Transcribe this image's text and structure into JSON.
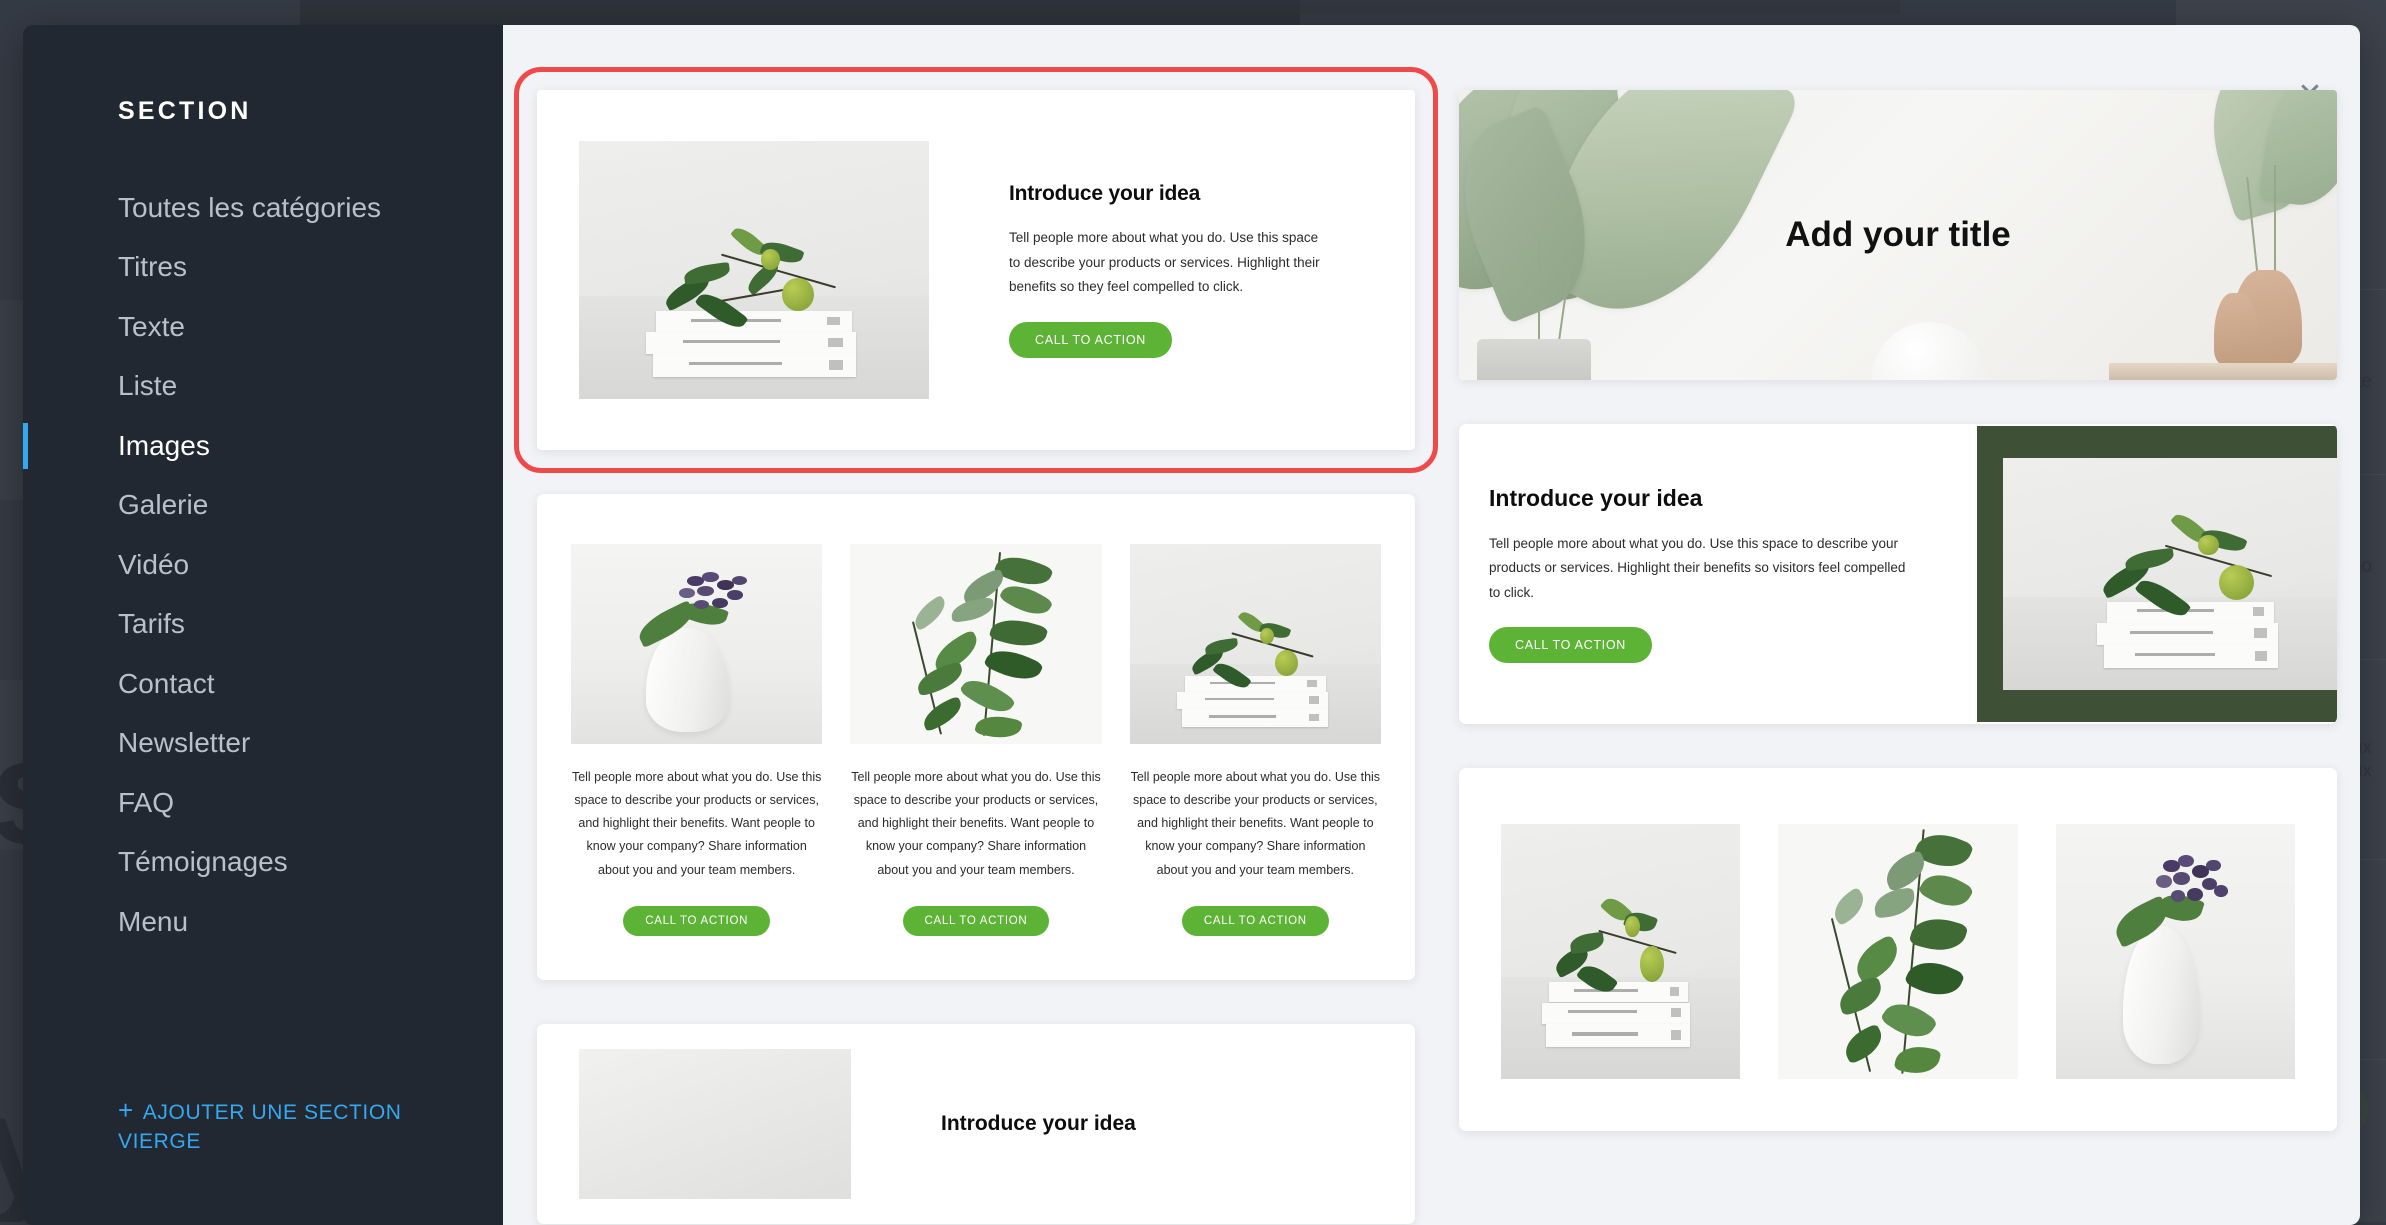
{
  "sidebar": {
    "title": "SECTION",
    "items": [
      {
        "label": "Toutes les catégories",
        "active": false
      },
      {
        "label": "Titres",
        "active": false
      },
      {
        "label": "Texte",
        "active": false
      },
      {
        "label": "Liste",
        "active": false
      },
      {
        "label": "Images",
        "active": true
      },
      {
        "label": "Galerie",
        "active": false
      },
      {
        "label": "Vidéo",
        "active": false
      },
      {
        "label": "Tarifs",
        "active": false
      },
      {
        "label": "Contact",
        "active": false
      },
      {
        "label": "Newsletter",
        "active": false
      },
      {
        "label": "FAQ",
        "active": false
      },
      {
        "label": "Témoignages",
        "active": false
      },
      {
        "label": "Menu",
        "active": false
      }
    ],
    "add_blank_plus": "+",
    "add_blank_label": "AJOUTER UNE SECTION VIERGE"
  },
  "modal": {
    "close_label": "✕"
  },
  "colors": {
    "sidebar_bg": "#222831",
    "accent_blue": "#35a8f0",
    "selection_red": "#ef4a4a",
    "cta_green": "#5cb335",
    "frame_green": "#3e5137",
    "content_bg": "#f2f3f7"
  },
  "templates": {
    "image_left": {
      "heading": "Introduce your idea",
      "body": "Tell people more about what you do. Use this space to describe your products or services. Highlight their benefits so they feel compelled to click.",
      "cta": "CALL TO ACTION"
    },
    "hero_banner": {
      "heading": "Add your title"
    },
    "three_columns": {
      "cta": "CALL TO ACTION",
      "columns": [
        {
          "body": "Tell people more about what you do. Use this space to describe your products or services, and highlight their benefits. Want people to know your company? Share information about you and your team members.",
          "cta": "CALL TO ACTION"
        },
        {
          "body": "Tell people more about what you do. Use this space to describe your products or services, and highlight their benefits. Want people to know your company? Share information about you and your team members.",
          "cta": "CALL TO ACTION"
        },
        {
          "body": "Tell people more about what you do. Use this space to describe your products or services, and highlight their benefits. Want people to know your company? Share information about you and your team members.",
          "cta": "CALL TO ACTION"
        }
      ]
    },
    "text_with_framed_image": {
      "heading": "Introduce your idea",
      "body": "Tell people more about what you do. Use this space to describe your products or services. Highlight their benefits so visitors feel compelled to click.",
      "cta": "CALL TO ACTION"
    },
    "gallery_three": {},
    "bottom_partial": {
      "heading": "Introduce your idea"
    }
  }
}
